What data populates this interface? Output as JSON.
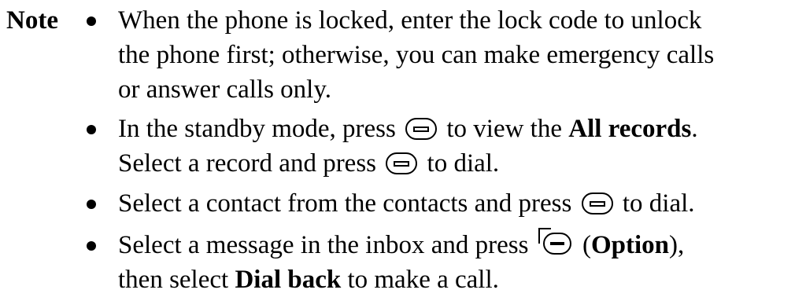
{
  "note_label": "Note",
  "bullets": [
    {
      "line1": "When the phone is locked, enter the lock code to unlock",
      "line2": "the phone first; otherwise, you can make emergency calls",
      "line3": "or answer calls only."
    },
    {
      "line1_a": "In the standby mode, press",
      "line1_b": "to view the",
      "line1_bold": "All records",
      "line1_end": ".",
      "line2_a": "Select a record and press",
      "line2_b": "to dial."
    },
    {
      "a": "Select a contact from the contacts and press",
      "b": "to dial."
    },
    {
      "a": "Select a message in the inbox and press",
      "paren_open": "(",
      "bold": "Option",
      "paren_close": "),",
      "line2_a": "then select",
      "line2_bold": "Dial back",
      "line2_b": "to make a call."
    }
  ],
  "icons": {
    "call_key": "call-key-icon",
    "option_key": "option-key-icon"
  }
}
